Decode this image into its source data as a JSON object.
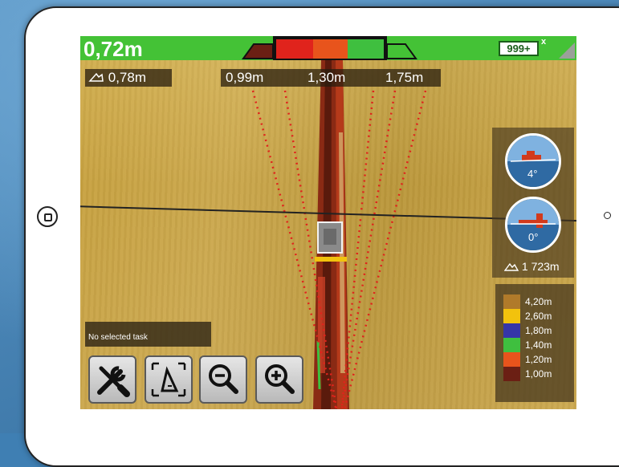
{
  "topbar": {
    "depth_value": "0,72m",
    "counter": "999+",
    "counter_close": "x"
  },
  "readouts": {
    "left_depth": "0,78m",
    "center_left": "0,99m",
    "center": "1,30m",
    "center_right": "1,75m"
  },
  "gauges": {
    "roll": "4°",
    "pitch": "0°",
    "altitude": "1 723m"
  },
  "legend": [
    {
      "label": "4,20m",
      "color": "#b07a2a"
    },
    {
      "label": "2,60m",
      "color": "#f2c20d"
    },
    {
      "label": "1,80m",
      "color": "#3535a8"
    },
    {
      "label": "1,40m",
      "color": "#3fbf3f"
    },
    {
      "label": "1,20m",
      "color": "#e8541c"
    },
    {
      "label": "1,00m",
      "color": "#6b1f14"
    }
  ],
  "task": {
    "status": "No selected task"
  },
  "toolbar": [
    {
      "icon": "tools-icon"
    },
    {
      "icon": "measure-icon"
    },
    {
      "icon": "zoom-out-icon"
    },
    {
      "icon": "zoom-in-icon"
    }
  ],
  "colors": {
    "topbar": "#44c236",
    "field": "#c9a83f",
    "panel": "#46371e"
  }
}
